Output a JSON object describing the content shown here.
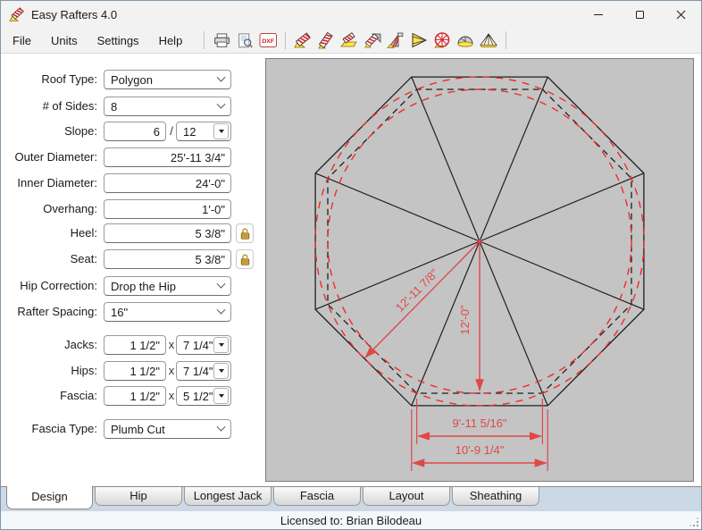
{
  "window": {
    "title": "Easy Rafters 4.0"
  },
  "menu": {
    "items": [
      "File",
      "Units",
      "Settings",
      "Help"
    ]
  },
  "toolbar": {
    "dxf_label": "DXF",
    "icons": [
      "print",
      "print-preview",
      "dxf-export",
      "common-rafter",
      "hip-rafter",
      "jack-rafter",
      "valley-rafter",
      "irregular-hip",
      "gable-roof",
      "polygon-roof",
      "dome-roof",
      "gazebo-roof"
    ]
  },
  "form": {
    "fields": [
      {
        "label": "Roof Type:",
        "type": "combo",
        "value": "Polygon"
      },
      {
        "label": "# of Sides:",
        "type": "combo",
        "value": "8"
      },
      {
        "label": "Slope:",
        "type": "split",
        "value1": "6",
        "sep": "/",
        "value2": "12"
      },
      {
        "label": "Outer Diameter:",
        "type": "input",
        "value": "25'-11 3/4\""
      },
      {
        "label": "Inner Diameter:",
        "type": "input",
        "value": "24'-0\""
      },
      {
        "label": "Overhang:",
        "type": "input",
        "value": "1'-0\""
      },
      {
        "label": "Heel:",
        "type": "input-lock",
        "value": "5 3/8\""
      },
      {
        "label": "Seat:",
        "type": "input-lock",
        "value": "5 3/8\""
      },
      {
        "label": "Hip Correction:",
        "type": "combo",
        "value": "Drop the Hip"
      },
      {
        "label": "Rafter Spacing:",
        "type": "combo",
        "value": "16\""
      },
      {
        "label": "Jacks:",
        "type": "split",
        "value1": "1 1/2\"",
        "sep": "x",
        "value2": "7 1/4\""
      },
      {
        "label": "Hips:",
        "type": "split",
        "value1": "1 1/2\"",
        "sep": "x",
        "value2": "7 1/4\""
      },
      {
        "label": "Fascia:",
        "type": "split",
        "value1": "1 1/2\"",
        "sep": "x",
        "value2": "5 1/2\""
      },
      {
        "label": "Fascia Type:",
        "type": "combo",
        "value": "Plumb Cut"
      }
    ]
  },
  "canvas": {
    "dimensions": {
      "hip_run": "12'-11 7/8\"",
      "run": "12'-0\"",
      "wall_side": "9'-11 5/16\"",
      "fascia_side": "10'-9 1/4\""
    },
    "colors": {
      "dimension_red": "#e04848",
      "circle_red": "#f22b2b",
      "line_black": "#1f1f1f",
      "background": "#c4c4c4"
    }
  },
  "tabs": {
    "items": [
      "Design",
      "Hip",
      "Longest Jack",
      "Fascia",
      "Layout",
      "Sheathing"
    ],
    "active": "Design"
  },
  "statusbar": {
    "text": "Licensed to: Brian Bilodeau"
  }
}
